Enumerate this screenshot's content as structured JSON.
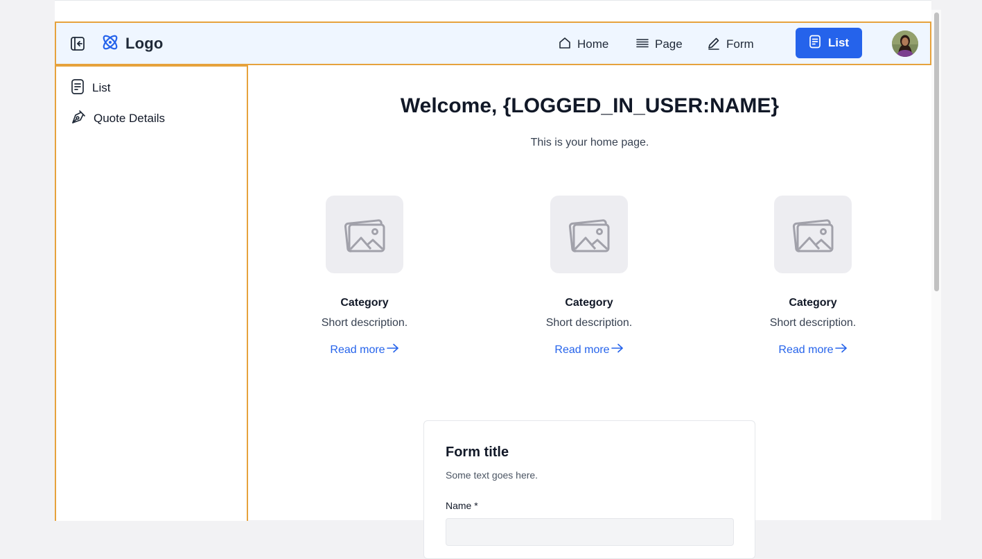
{
  "header": {
    "brand": "Logo",
    "nav": [
      {
        "label": "Home",
        "icon": "home-icon"
      },
      {
        "label": "Page",
        "icon": "lines-icon"
      },
      {
        "label": "Form",
        "icon": "pen-icon"
      }
    ],
    "active_button": {
      "label": "List",
      "icon": "document-icon"
    },
    "accent_color": "#2563eb",
    "highlight_border_color": "#e6a23c"
  },
  "sidebar": {
    "items": [
      {
        "label": "List",
        "icon": "document-icon"
      },
      {
        "label": "Quote Details",
        "icon": "pen-nib-icon"
      }
    ]
  },
  "main": {
    "welcome": "Welcome, {LOGGED_IN_USER:NAME}",
    "subtitle": "This is your home page.",
    "cards": [
      {
        "title": "Category",
        "description": "Short description.",
        "link": "Read more"
      },
      {
        "title": "Category",
        "description": "Short description.",
        "link": "Read more"
      },
      {
        "title": "Category",
        "description": "Short description.",
        "link": "Read more"
      }
    ],
    "form": {
      "title": "Form title",
      "text": "Some text goes here.",
      "name_label": "Name *"
    }
  }
}
